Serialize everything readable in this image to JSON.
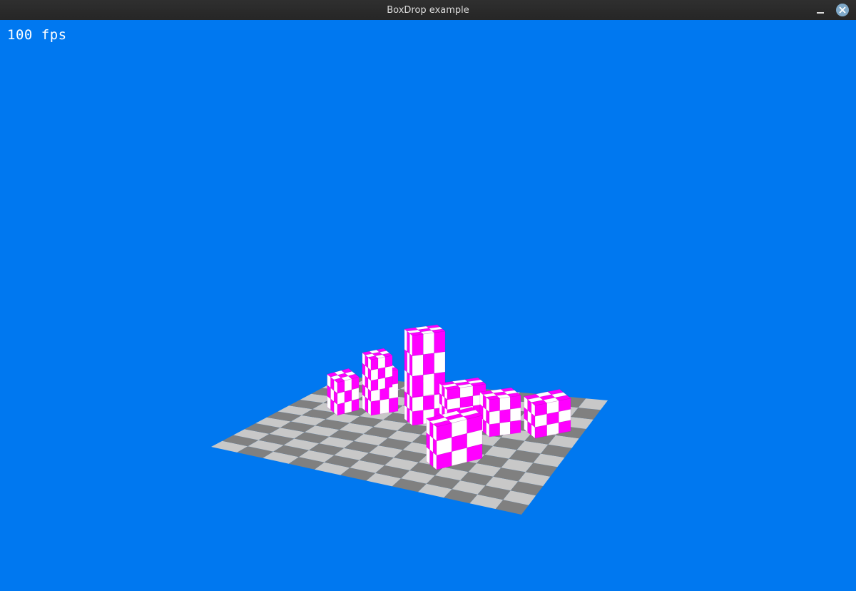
{
  "window": {
    "title": "BoxDrop example"
  },
  "controls": {
    "minimize_glyph": "_",
    "close_glyph": "×"
  },
  "hud": {
    "fps": "100 fps"
  },
  "scene": {
    "background_color": "#0078f0",
    "floor": {
      "tiles": 12,
      "light": "#c8c8c8",
      "dark": "#808080"
    },
    "boxes": {
      "primary": "#ff00ff",
      "secondary": "#ffffff",
      "count": 14
    }
  }
}
